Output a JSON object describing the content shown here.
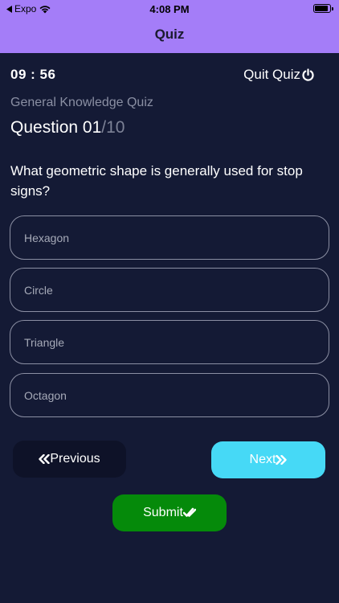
{
  "status_bar": {
    "carrier": "Expo",
    "time": "4:08 PM"
  },
  "header": {
    "title": "Quiz"
  },
  "quiz": {
    "timer": "09 : 56",
    "quit_label": "Quit Quiz",
    "name": "General Knowledge Quiz",
    "question_label": "Question 01",
    "question_total": "/10",
    "question_text": "What geometric shape is generally used for stop signs?",
    "options": [
      {
        "label": "Hexagon"
      },
      {
        "label": "Circle"
      },
      {
        "label": "Triangle"
      },
      {
        "label": "Octagon"
      }
    ]
  },
  "buttons": {
    "previous_label": "Previous",
    "next_label": "Next",
    "submit_label": "Submit"
  },
  "colors": {
    "header": "#a47df8",
    "background": "#141a35",
    "next": "#46d9f6",
    "submit": "#058a0a"
  },
  "icons": {
    "back": "back-arrow-icon",
    "wifi": "wifi-icon",
    "battery": "battery-icon",
    "power": "power-icon",
    "prev": "double-chevron-left-icon",
    "next": "double-chevron-right-icon",
    "submit": "double-check-icon"
  }
}
